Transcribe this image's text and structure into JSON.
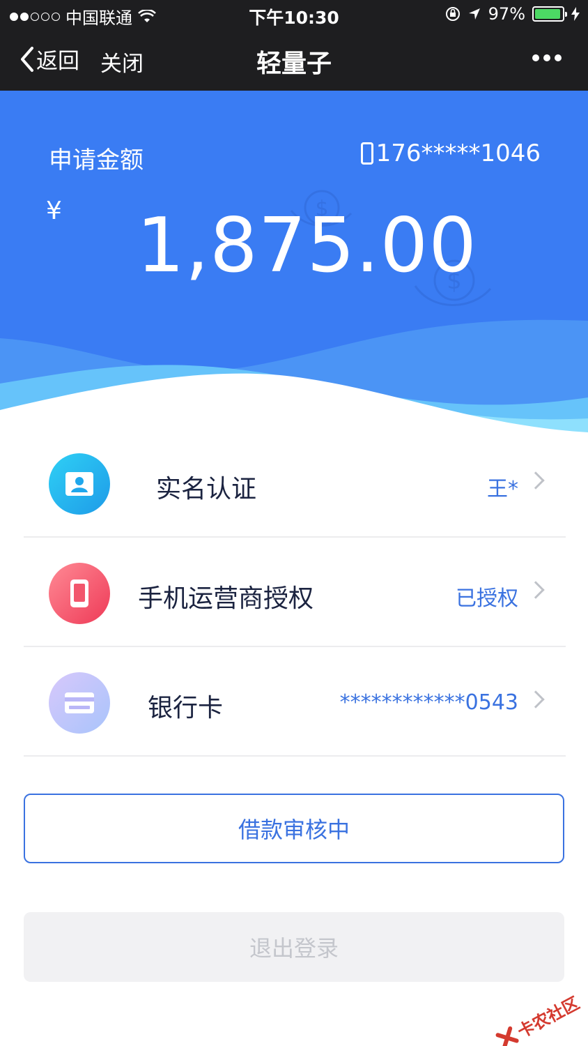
{
  "status_bar": {
    "carrier": "中国联通",
    "time": "下午10:30",
    "battery": "97%"
  },
  "nav": {
    "back_label": "返回",
    "close_label": "关闭",
    "title": "轻量子"
  },
  "header": {
    "amount_label": "申请金额",
    "phone": "176*****1046",
    "currency": "¥",
    "amount": "1,875.00"
  },
  "list": [
    {
      "label": "实名认证",
      "value": "王*",
      "icon": "id-card-icon"
    },
    {
      "label": "手机运营商授权",
      "value": "已授权",
      "icon": "mobile-phone-icon"
    },
    {
      "label": "银行卡",
      "value": "************0543",
      "icon": "bank-card-icon"
    }
  ],
  "buttons": {
    "status": "借款审核中",
    "logout": "退出登录"
  },
  "watermark": "卡农社区",
  "colors": {
    "header_blue": "#3a7cf3",
    "accent": "#3a72e0",
    "battery_green": "#4cd964"
  }
}
